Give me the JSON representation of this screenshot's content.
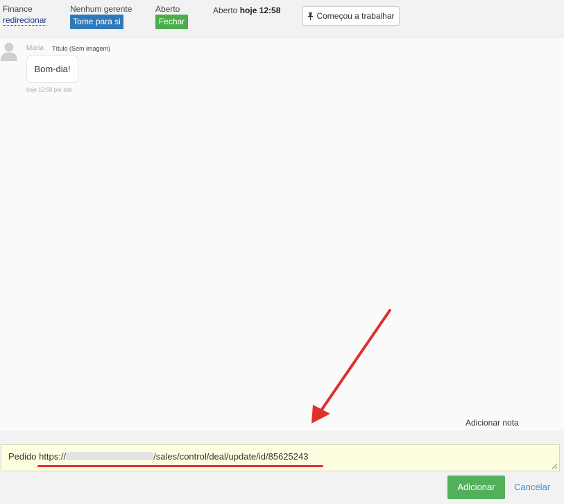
{
  "header": {
    "group_label": "Finance",
    "redirect_link": "redirecionar",
    "manager_label": "Nenhum gerente",
    "take_button": "Tome para si",
    "status_label": "Aberto",
    "close_button": "Fechar",
    "opened_prefix": "Aberto",
    "opened_time": "hoje 12:58",
    "pin_icon": "pin-icon",
    "started_button": "Começou a trabalhar"
  },
  "message": {
    "author": "Maria",
    "title": "Título (Sem imagem)",
    "text": "Bom-dia!",
    "meta": "hoje 12:58 por site"
  },
  "note": {
    "add_note_label": "Adicionar nota",
    "text_prefix": "Pedido https://",
    "text_suffix": "/sales/control/deal/update/id/85625243",
    "submit_button": "Adicionar",
    "cancel_link": "Cancelar"
  },
  "annotation": {
    "arrow_color": "#e0302d",
    "underline_color": "#e0302d"
  },
  "colors": {
    "primary": "#2f79b9",
    "success": "#4cad4c",
    "link": "#3a8fd1"
  }
}
